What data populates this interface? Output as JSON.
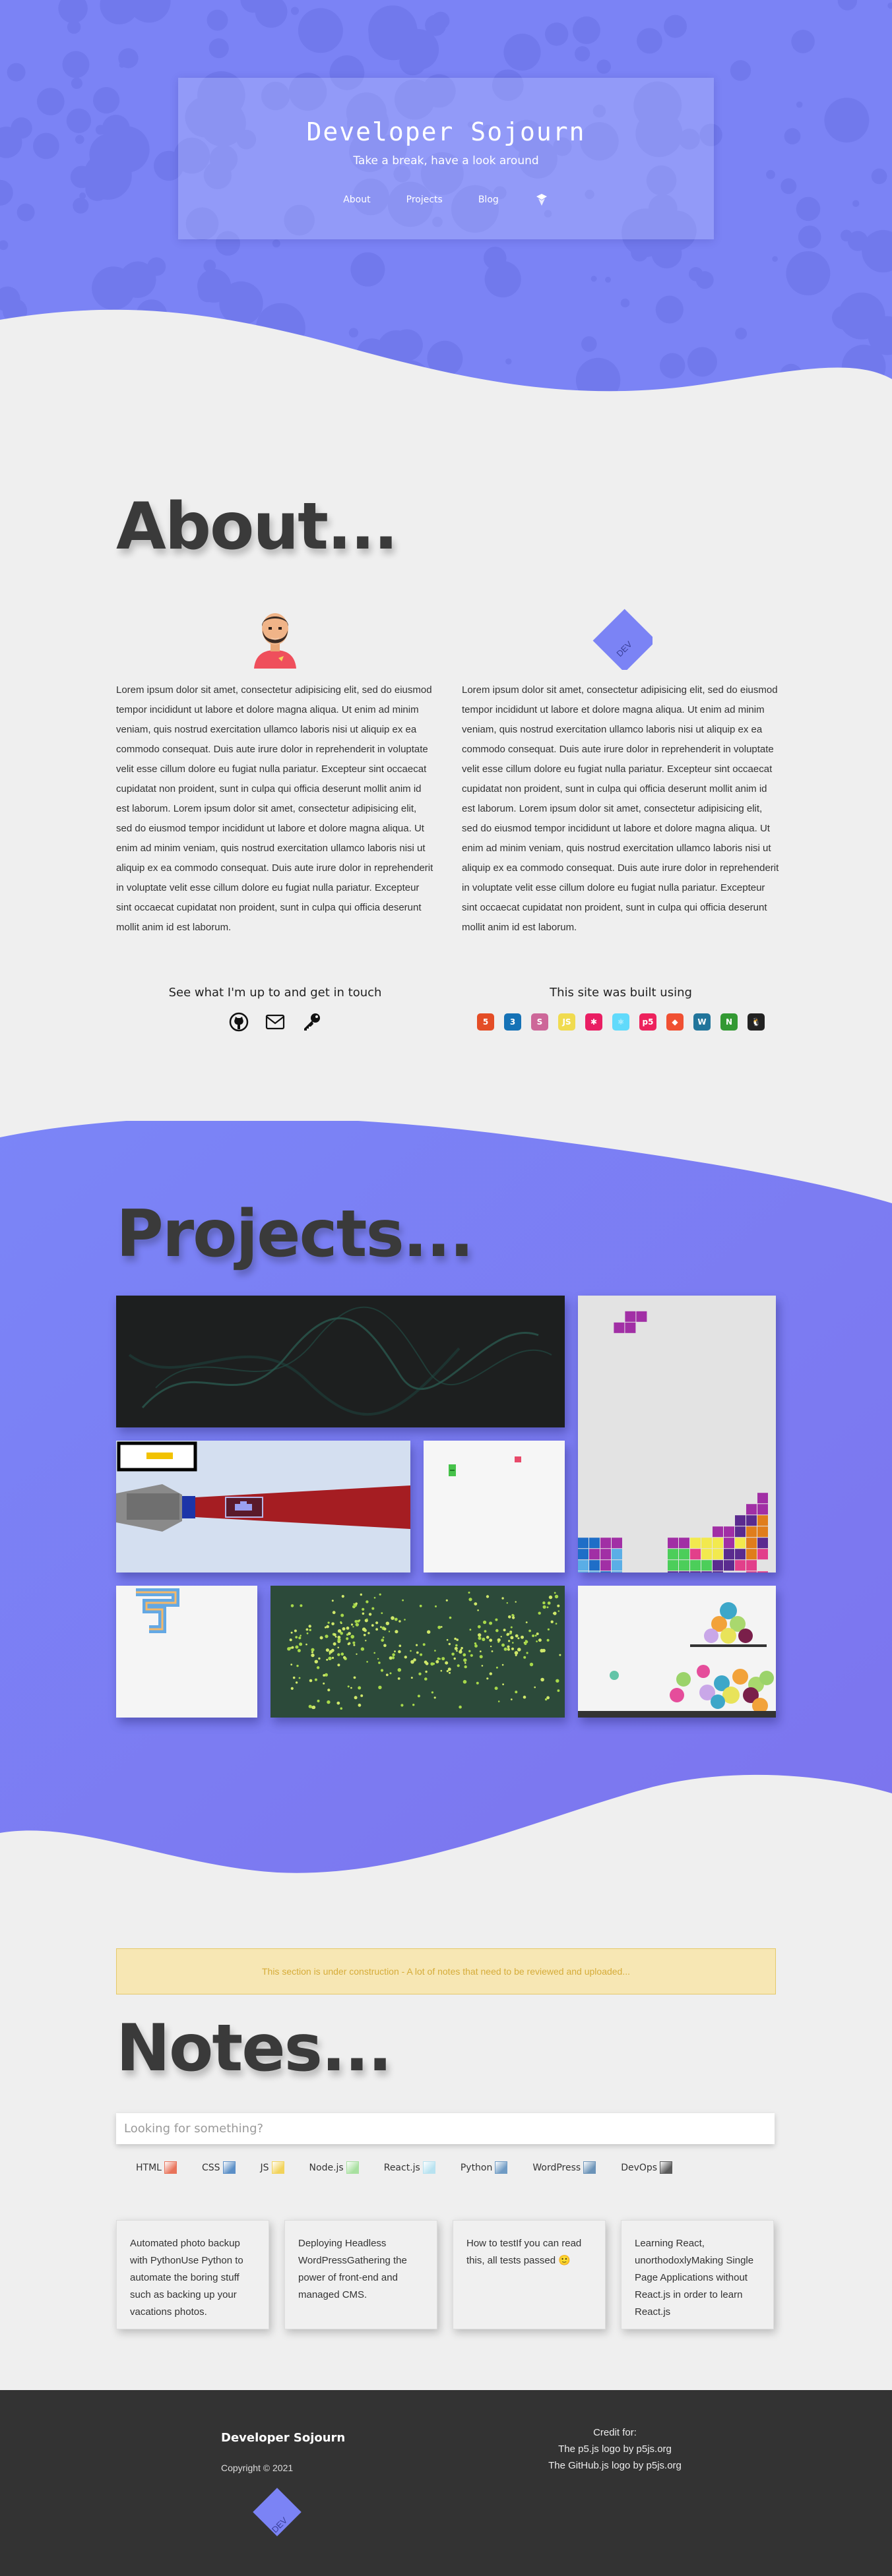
{
  "site": {
    "title": "Developer Sojourn",
    "tagline": "Take a break, have a look around"
  },
  "nav": {
    "items": [
      {
        "label": "About"
      },
      {
        "label": "Projects"
      },
      {
        "label": "Blog"
      }
    ],
    "dev_icon": "dev-logo-icon"
  },
  "about": {
    "title": "About...",
    "left": {
      "avatar": "bearded-developer-avatar",
      "text": "Lorem ipsum dolor sit amet, consectetur adipisicing elit, sed do eiusmod tempor incididunt ut labore et dolore magna aliqua. Ut enim ad minim veniam, quis nostrud exercitation ullamco laboris nisi ut aliquip ex ea commodo consequat. Duis aute irure dolor in reprehenderit in voluptate velit esse cillum dolore eu fugiat nulla pariatur. Excepteur sint occaecat cupidatat non proident, sunt in culpa qui officia deserunt mollit anim id est laborum. Lorem ipsum dolor sit amet, consectetur adipisicing elit, sed do eiusmod tempor incididunt ut labore et dolore magna aliqua. Ut enim ad minim veniam, quis nostrud exercitation ullamco laboris nisi ut aliquip ex ea commodo consequat. Duis aute irure dolor in reprehenderit in voluptate velit esse cillum dolore eu fugiat nulla pariatur. Excepteur sint occaecat cupidatat non proident, sunt in culpa qui officia deserunt mollit anim id est laborum.",
      "heading": "See what I'm up to and get in touch",
      "contact_icons": [
        "github-icon",
        "mail-icon",
        "key-icon"
      ]
    },
    "right": {
      "logo": "dev-diamond-logo",
      "text": "Lorem ipsum dolor sit amet, consectetur adipisicing elit, sed do eiusmod tempor incididunt ut labore et dolore magna aliqua. Ut enim ad minim veniam, quis nostrud exercitation ullamco laboris nisi ut aliquip ex ea commodo consequat. Duis aute irure dolor in reprehenderit in voluptate velit esse cillum dolore eu fugiat nulla pariatur. Excepteur sint occaecat cupidatat non proident, sunt in culpa qui officia deserunt mollit anim id est laborum. Lorem ipsum dolor sit amet, consectetur adipisicing elit, sed do eiusmod tempor incididunt ut labore et dolore magna aliqua. Ut enim ad minim veniam, quis nostrud exercitation ullamco laboris nisi ut aliquip ex ea commodo consequat. Duis aute irure dolor in reprehenderit in voluptate velit esse cillum dolore eu fugiat nulla pariatur. Excepteur sint occaecat cupidatat non proident, sunt in culpa qui officia deserunt mollit anim id est laborum.",
      "heading": "This site was built using",
      "tech_icons": [
        {
          "name": "html5-icon",
          "color": "#e44d26",
          "glyph": "5"
        },
        {
          "name": "css3-icon",
          "color": "#1572b6",
          "glyph": "3"
        },
        {
          "name": "sass-icon",
          "color": "#cd6799",
          "glyph": "S"
        },
        {
          "name": "javascript-icon",
          "color": "#f0db4f",
          "glyph": "JS"
        },
        {
          "name": "star-icon",
          "color": "#e91e63",
          "glyph": "✱"
        },
        {
          "name": "react-icon",
          "color": "#61dafb",
          "glyph": "⚛"
        },
        {
          "name": "p5js-icon",
          "color": "#ed225d",
          "glyph": "p5"
        },
        {
          "name": "git-icon",
          "color": "#f05032",
          "glyph": "◆"
        },
        {
          "name": "wordpress-icon",
          "color": "#21759b",
          "glyph": "W"
        },
        {
          "name": "nodejs-icon",
          "color": "#339933",
          "glyph": "N"
        },
        {
          "name": "linux-icon",
          "color": "#222222",
          "glyph": "🐧"
        }
      ]
    }
  },
  "projects": {
    "title": "Projects...",
    "tiles": [
      {
        "name": "project-smoke-tile"
      },
      {
        "name": "project-tetris-tile"
      },
      {
        "name": "project-robot-arm-tile"
      },
      {
        "name": "project-snake-tile"
      },
      {
        "name": "project-maze-tile"
      },
      {
        "name": "project-particles-tile"
      },
      {
        "name": "project-balls-tile"
      }
    ]
  },
  "notes": {
    "notice": "This section is under construction - A lot of notes that need to be reviewed and uploaded...",
    "title": "Notes...",
    "search_placeholder": "Looking for something?",
    "tags": [
      {
        "label": "HTML",
        "color": "#e8735a"
      },
      {
        "label": "CSS",
        "color": "#5b8fc7"
      },
      {
        "label": "JS",
        "color": "#f2d35b"
      },
      {
        "label": "Node.js",
        "color": "#a8e0a0"
      },
      {
        "label": "React.js",
        "color": "#b8e2f0"
      },
      {
        "label": "Python",
        "color": "#6f9bc4"
      },
      {
        "label": "WordPress",
        "color": "#6b93b8"
      },
      {
        "label": "DevOps",
        "color": "#5a5a5a"
      }
    ],
    "cards": [
      {
        "text": "Automated photo backup with PythonUse Python to automate the boring stuff such as backing up your vacations photos."
      },
      {
        "text": "Deploying Headless WordPressGathering the power of front-end and managed CMS."
      },
      {
        "text": "How to testIf you can read this, all tests passed 🙂"
      },
      {
        "text": "Learning React, unorthodoxlyMaking Single Page Applications without React.js in order to learn React.js"
      }
    ]
  },
  "footer": {
    "title": "Developer Sojourn",
    "copyright": "Copyright © 2021",
    "credit_title": "Credit for:",
    "credits": [
      "The p5.js logo by p5js.org",
      "The GitHub.js logo by p5js.org"
    ]
  },
  "colors": {
    "brand": "#7b83f5",
    "brand_dark": "#6a72ee",
    "projects_bg": "#7a82f6",
    "footer": "#333333"
  }
}
